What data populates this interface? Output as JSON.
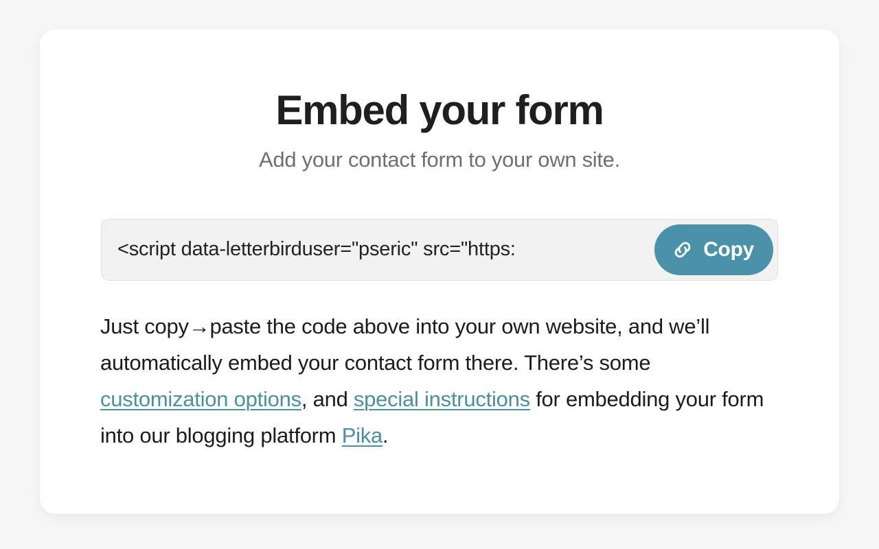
{
  "card": {
    "title": "Embed your form",
    "subtitle": "Add your contact form to your own site.",
    "embed": {
      "code": "<script data-letterbirduser=\"pseric\" src=\"https:",
      "copy_label": "Copy",
      "copy_icon": "link-icon",
      "button_color": "#4a92aa",
      "field_bg": "#f2f2f2",
      "field_border": "#e0e0e0"
    },
    "description": {
      "part1": "Just copy→paste the code above into your own website, and we’ll automatically embed your contact form there. There’s some ",
      "link1": "customization options",
      "part2": ", and ",
      "link2": "special instructions",
      "part3": " for embedding your form into our blogging platform ",
      "link3": "Pika",
      "part4": ".",
      "link_color": "#4a8fa3"
    }
  },
  "theme": {
    "page_bg": "#f7f7f7",
    "card_bg": "#ffffff",
    "title_color": "#1f1f1f",
    "subtitle_color": "#6f6f6f",
    "body_color": "#1c1c1c"
  }
}
